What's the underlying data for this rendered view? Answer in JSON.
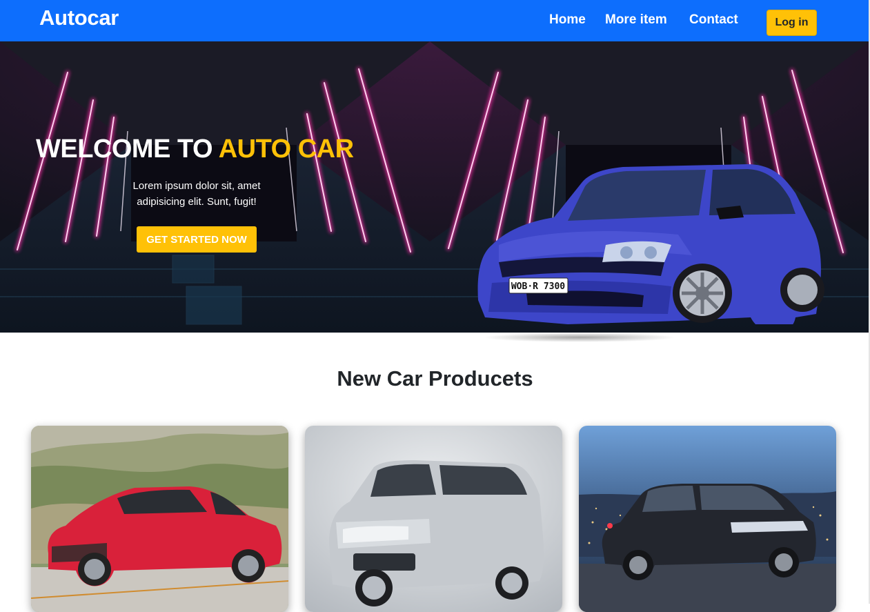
{
  "navbar": {
    "brand": "Autocar",
    "links": [
      "Home",
      "More item",
      "Contact"
    ],
    "login_label": "Log in"
  },
  "hero": {
    "title_prefix": "WELCOME TO ",
    "title_accent": "AUTO CAR",
    "text": "Lorem ipsum dolor sit, amet adipisicing elit. Sunt, fugit!",
    "cta_label": "GET STARTED NOW",
    "plate": "WOB·R 7300"
  },
  "products": {
    "title": "New Car Producets",
    "cards": [
      {
        "image": "red-sedan"
      },
      {
        "image": "silver-suv"
      },
      {
        "image": "dark-hatchback-city-night"
      }
    ]
  },
  "colors": {
    "primary": "#0d6efd",
    "accent": "#ffc107",
    "neon": "#ff2fa8"
  }
}
